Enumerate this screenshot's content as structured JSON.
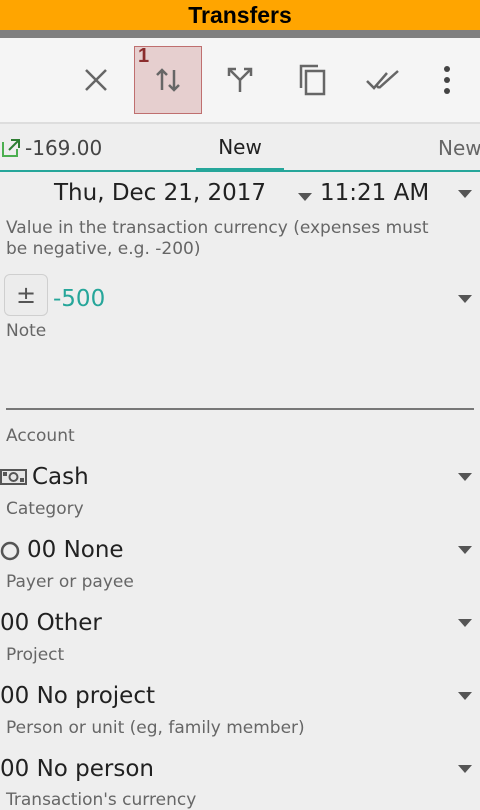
{
  "app": {
    "title": "Transfers"
  },
  "toolbar": {
    "active_badge": "1"
  },
  "tabs": {
    "left_value": "-169.00",
    "center_label": "New",
    "right_label": "New"
  },
  "datetime": {
    "date": "Thu, Dec 21, 2017",
    "time": "11:21 AM"
  },
  "amount": {
    "hint": "Value in the transaction currency (expenses must be negative, e.g. -200)",
    "sign_label": "±",
    "value": "-500"
  },
  "note": {
    "label": "Note"
  },
  "account": {
    "label": "Account",
    "value": "Cash"
  },
  "category": {
    "label": "Category",
    "value": "00 None"
  },
  "payee": {
    "label": "Payer or payee",
    "value": "00 Other"
  },
  "project": {
    "label": "Project",
    "value": "00 No project"
  },
  "person": {
    "label": "Person or unit (eg, family member)",
    "value": "00 No person"
  },
  "currency": {
    "label": "Transaction's currency"
  },
  "colors": {
    "title_bar": "#ffa500",
    "accent": "#26a69a",
    "active_highlight": "#e6cfcf"
  }
}
